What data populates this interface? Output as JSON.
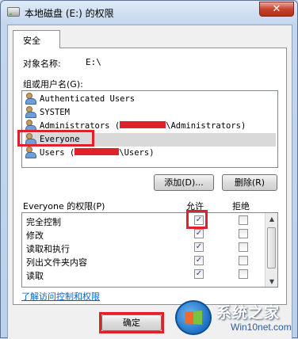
{
  "window": {
    "title": "本地磁盘 (E:) 的权限",
    "close_label": "✕"
  },
  "tab": {
    "label": "安全"
  },
  "object": {
    "label": "对象名称:",
    "value": "E:\\"
  },
  "principals": {
    "label": "组或用户名(G):",
    "items": [
      {
        "name": "Authenticated Users",
        "suffix": ""
      },
      {
        "name": "SYSTEM",
        "suffix": ""
      },
      {
        "name": "Administrators (",
        "suffix": "\\Administrators)"
      },
      {
        "name": "Everyone",
        "suffix": ""
      },
      {
        "name": "Users (",
        "suffix": "\\Users)"
      }
    ],
    "selected": "Everyone"
  },
  "buttons": {
    "add": "添加(D)...",
    "remove": "删除(R)",
    "ok": "确定"
  },
  "permissions": {
    "label": "Everyone 的权限(P)",
    "allow_header": "允许",
    "deny_header": "拒绝",
    "rows": [
      {
        "name": "完全控制",
        "allow": true,
        "deny": false
      },
      {
        "name": "修改",
        "allow": true,
        "deny": false
      },
      {
        "name": "读取和执行",
        "allow": true,
        "deny": false
      },
      {
        "name": "列出文件夹内容",
        "allow": true,
        "deny": false
      },
      {
        "name": "读取",
        "allow": true,
        "deny": false
      }
    ]
  },
  "link": {
    "label": "了解访问控制和权限"
  },
  "watermark": {
    "cn": "系统之家",
    "en": "Win10net.com"
  },
  "colors": {
    "highlight": "#e0202a",
    "link": "#0066cc",
    "check": "#2a3f85"
  },
  "icons": {
    "user": "user-group-icon",
    "close": "close-icon"
  }
}
